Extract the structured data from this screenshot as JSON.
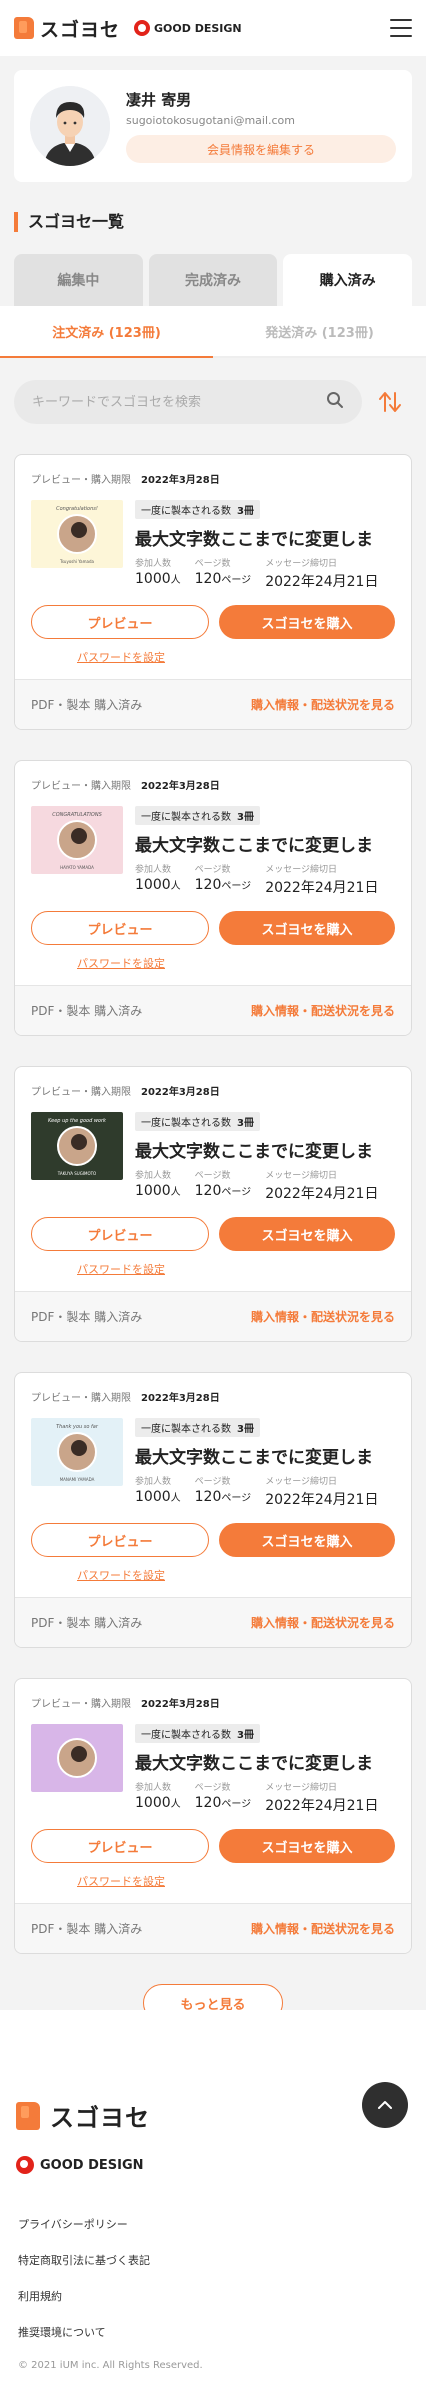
{
  "header": {
    "logo_text": "スゴヨセ",
    "good_design": "GOOD DESIGN"
  },
  "profile": {
    "name": "凄井 寄男",
    "email": "sugoiotokosugotani@mail.com",
    "edit_label": "会員情報を編集する"
  },
  "section_title": "スゴヨセ一覧",
  "tabs": [
    {
      "label": "編集中"
    },
    {
      "label": "完成済み"
    },
    {
      "label": "購入済み",
      "active": true
    }
  ],
  "subtabs": [
    {
      "label": "注文済み (123冊)",
      "active": true
    },
    {
      "label": "発送済み (123冊)"
    }
  ],
  "search": {
    "placeholder": "キーワードでスゴヨセを検索"
  },
  "cards": [
    {
      "period_label": "プレビュー・購入期限",
      "period_date": "2022年3月28日",
      "count_label": "一度に製本される数",
      "count_value": "3冊",
      "title": "最大文字数ここまでに変更しま",
      "participants_label": "参加人数",
      "participants_value": "1000",
      "participants_unit": "人",
      "pages_label": "ページ数",
      "pages_value": "120",
      "pages_unit": "ページ",
      "deadline_label": "メッセージ締切日",
      "deadline_value": "2022年24月21日",
      "preview_label": "プレビュー",
      "buy_label": "スゴヨセを購入",
      "password_label": "パスワードを設定",
      "foot_left": "PDF・製本 購入済み",
      "foot_right": "購入情報・配送状況を見る",
      "thumb_bg": "#fdf6d8",
      "thumb_top": "Congratulations!",
      "thumb_bottom": "Tsuyoshi Yamada"
    },
    {
      "period_label": "プレビュー・購入期限",
      "period_date": "2022年3月28日",
      "count_label": "一度に製本される数",
      "count_value": "3冊",
      "title": "最大文字数ここまでに変更しま",
      "participants_label": "参加人数",
      "participants_value": "1000",
      "participants_unit": "人",
      "pages_label": "ページ数",
      "pages_value": "120",
      "pages_unit": "ページ",
      "deadline_label": "メッセージ締切日",
      "deadline_value": "2022年24月21日",
      "preview_label": "プレビュー",
      "buy_label": "スゴヨセを購入",
      "password_label": "パスワードを設定",
      "foot_left": "PDF・製本 購入済み",
      "foot_right": "購入情報・配送状況を見る",
      "thumb_bg": "#f6d9df",
      "thumb_top": "CONGRATULATIONS",
      "thumb_bottom": "HAYATO YAMADA"
    },
    {
      "period_label": "プレビュー・購入期限",
      "period_date": "2022年3月28日",
      "count_label": "一度に製本される数",
      "count_value": "3冊",
      "title": "最大文字数ここまでに変更しま",
      "participants_label": "参加人数",
      "participants_value": "1000",
      "participants_unit": "人",
      "pages_label": "ページ数",
      "pages_value": "120",
      "pages_unit": "ページ",
      "deadline_label": "メッセージ締切日",
      "deadline_value": "2022年24月21日",
      "preview_label": "プレビュー",
      "buy_label": "スゴヨセを購入",
      "password_label": "パスワードを設定",
      "foot_left": "PDF・製本 購入済み",
      "foot_right": "購入情報・配送状況を見る",
      "thumb_bg": "#2f3b2c",
      "thumb_top": "Keep up the good work",
      "thumb_bottom": "TAKUYA SUGIMOTO"
    },
    {
      "period_label": "プレビュー・購入期限",
      "period_date": "2022年3月28日",
      "count_label": "一度に製本される数",
      "count_value": "3冊",
      "title": "最大文字数ここまでに変更しま",
      "participants_label": "参加人数",
      "participants_value": "1000",
      "participants_unit": "人",
      "pages_label": "ページ数",
      "pages_value": "120",
      "pages_unit": "ページ",
      "deadline_label": "メッセージ締切日",
      "deadline_value": "2022年24月21日",
      "preview_label": "プレビュー",
      "buy_label": "スゴヨセを購入",
      "password_label": "パスワードを設定",
      "foot_left": "PDF・製本 購入済み",
      "foot_right": "購入情報・配送状況を見る",
      "thumb_bg": "#e3f1f7",
      "thumb_top": "Thank you so far",
      "thumb_bottom": "MANAMI YAMADA"
    },
    {
      "period_label": "プレビュー・購入期限",
      "period_date": "2022年3月28日",
      "count_label": "一度に製本される数",
      "count_value": "3冊",
      "title": "最大文字数ここまでに変更しま",
      "participants_label": "参加人数",
      "participants_value": "1000",
      "participants_unit": "人",
      "pages_label": "ページ数",
      "pages_value": "120",
      "pages_unit": "ページ",
      "deadline_label": "メッセージ締切日",
      "deadline_value": "2022年24月21日",
      "preview_label": "プレビュー",
      "buy_label": "スゴヨセを購入",
      "password_label": "パスワードを設定",
      "foot_left": "PDF・製本 購入済み",
      "foot_right": "購入情報・配送状況を見る",
      "thumb_bg": "#d8b6e8",
      "thumb_top": "",
      "thumb_bottom": ""
    }
  ],
  "more_label": "もっと見る",
  "footer": {
    "logo_text": "スゴヨセ",
    "good_design": "GOOD DESIGN",
    "links": [
      "プライバシーポリシー",
      "特定商取引法に基づく表記",
      "利用規約",
      "推奨環境について"
    ],
    "copyright": "© 2021 iUM inc. All Rights Reserved."
  },
  "colors": {
    "accent": "#f47b3a",
    "background": "#f3f3f3"
  }
}
